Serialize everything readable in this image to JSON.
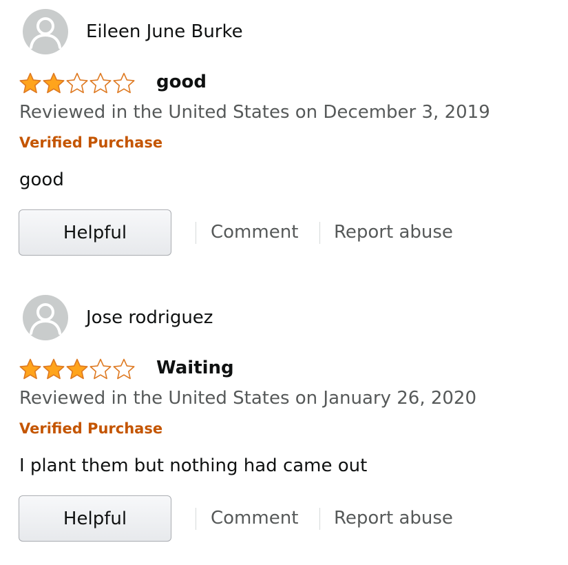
{
  "colors": {
    "star_fill": "#ffa41c",
    "star_stroke": "#de7921",
    "verified": "#c45500",
    "muted_text": "#565959",
    "avatar_bg": "#c9cccc"
  },
  "reviews": [
    {
      "author": "Eileen June Burke",
      "avatar_icon": "default-user-avatar-icon",
      "rating": 2,
      "max_rating": 5,
      "title": "good",
      "meta": "Reviewed in the United States on December 3, 2019",
      "verified": "Verified Purchase",
      "body": "good",
      "actions": {
        "helpful": "Helpful",
        "comment": "Comment",
        "report": "Report abuse"
      }
    },
    {
      "author": "Jose rodriguez",
      "avatar_icon": "default-user-avatar-icon",
      "rating": 3,
      "max_rating": 5,
      "title": "Waiting",
      "meta": "Reviewed in the United States on January 26, 2020",
      "verified": "Verified Purchase",
      "body": "I plant them but nothing had came out",
      "actions": {
        "helpful": "Helpful",
        "comment": "Comment",
        "report": "Report abuse"
      }
    }
  ]
}
